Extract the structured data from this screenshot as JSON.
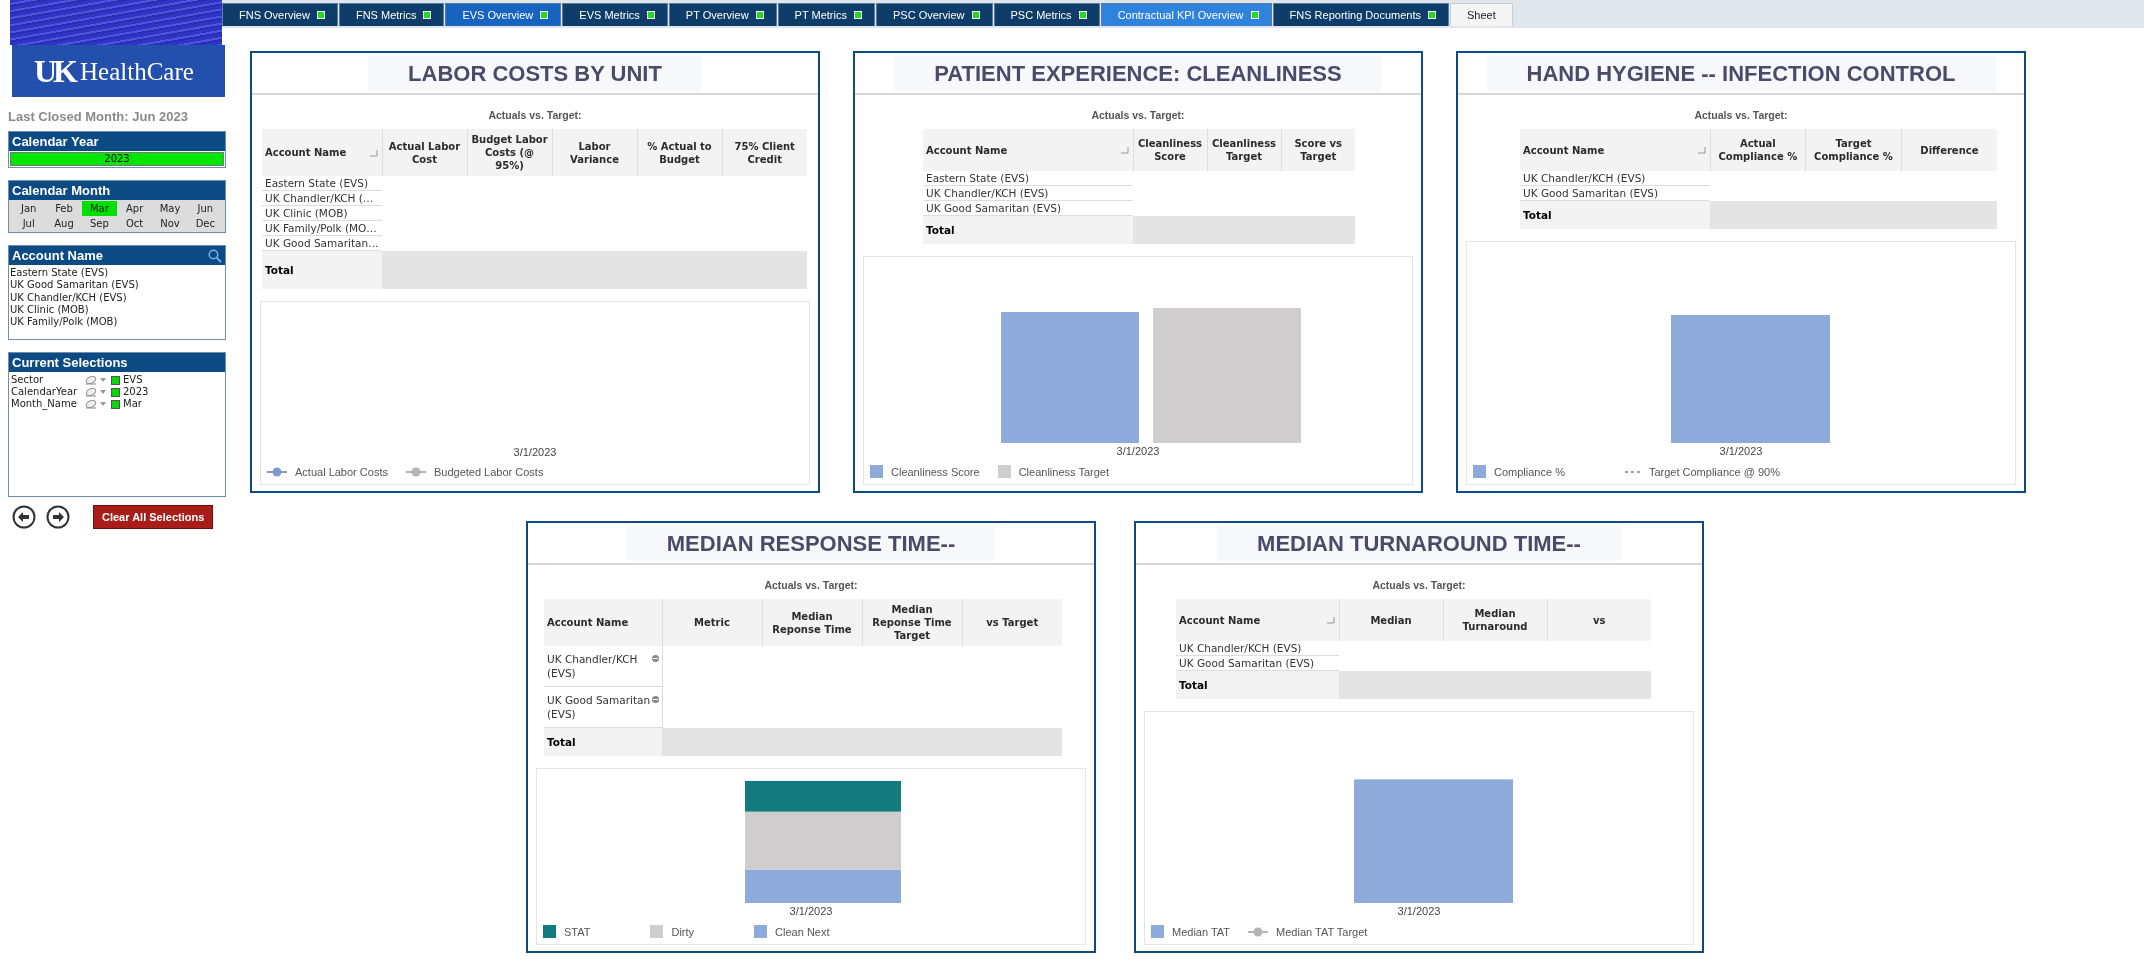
{
  "tabs": [
    {
      "label": "FNS Overview",
      "kind": "dashboard",
      "selected": false,
      "highlighted": false
    },
    {
      "label": "FNS Metrics",
      "kind": "dashboard",
      "selected": false,
      "highlighted": false
    },
    {
      "label": "EVS Overview",
      "kind": "dashboard",
      "selected": true,
      "highlighted": false
    },
    {
      "label": "EVS Metrics",
      "kind": "dashboard",
      "selected": false,
      "highlighted": false
    },
    {
      "label": "PT Overview",
      "kind": "dashboard",
      "selected": false,
      "highlighted": false
    },
    {
      "label": "PT Metrics",
      "kind": "dashboard",
      "selected": false,
      "highlighted": false
    },
    {
      "label": "PSC Overview",
      "kind": "dashboard",
      "selected": false,
      "highlighted": false
    },
    {
      "label": "PSC Metrics",
      "kind": "dashboard",
      "selected": false,
      "highlighted": false
    },
    {
      "label": "Contractual KPI Overview",
      "kind": "dashboard",
      "selected": false,
      "highlighted": true
    },
    {
      "label": "FNS Reporting Documents",
      "kind": "dashboard",
      "selected": false,
      "highlighted": false
    },
    {
      "label": "Sheet",
      "kind": "plain",
      "selected": false,
      "highlighted": false
    }
  ],
  "sidebar": {
    "logo": {
      "mark": "UK",
      "name": "HealthCare"
    },
    "last_closed": "Last Closed Month: Jun 2023",
    "calendar_year": {
      "title": "Calendar Year",
      "values": [
        {
          "label": "2023",
          "selected": true
        }
      ]
    },
    "calendar_month": {
      "title": "Calendar Month",
      "months": [
        {
          "label": "Jan",
          "selected": false
        },
        {
          "label": "Feb",
          "selected": false
        },
        {
          "label": "Mar",
          "selected": true
        },
        {
          "label": "Apr",
          "selected": false
        },
        {
          "label": "May",
          "selected": false
        },
        {
          "label": "Jun",
          "selected": false
        },
        {
          "label": "Jul",
          "selected": false
        },
        {
          "label": "Aug",
          "selected": false
        },
        {
          "label": "Sep",
          "selected": false
        },
        {
          "label": "Oct",
          "selected": false
        },
        {
          "label": "Nov",
          "selected": false
        },
        {
          "label": "Dec",
          "selected": false
        }
      ]
    },
    "account_name": {
      "title": "Account Name",
      "items": [
        "Eastern State (EVS)",
        "UK Good Samaritan (EVS)",
        "UK Chandler/KCH (EVS)",
        "UK Clinic (MOB)",
        "UK Family/Polk (MOB)"
      ]
    },
    "current_selections": {
      "title": "Current Selections",
      "rows": [
        {
          "field": "Sector",
          "value": "EVS"
        },
        {
          "field": "CalendarYear",
          "value": "2023"
        },
        {
          "field": "Month_Name",
          "value": "Mar"
        }
      ]
    },
    "clear_button": "Clear All Selections"
  },
  "panels": [
    {
      "title": "LABOR COSTS BY UNIT",
      "subtitle": "Actuals vs. Target:",
      "table": {
        "sort_indicator": true,
        "columns": [
          "Account Name",
          "Actual Labor Cost",
          "Budget Labor Costs (@ 95%)",
          "Labor Variance",
          "% Actual to Budget",
          "75% Client Credit"
        ],
        "rows": [
          {
            "name": "Eastern State (EVS)",
            "collapsible": false
          },
          {
            "name": "UK Chandler/KCH (…",
            "collapsible": false
          },
          {
            "name": "UK Clinic (MOB)",
            "collapsible": false
          },
          {
            "name": "UK Family/Polk (MO…",
            "collapsible": false
          },
          {
            "name": "UK Good Samaritan…",
            "collapsible": false
          }
        ],
        "total": "Total"
      },
      "chart": {
        "kind": "empty",
        "x_label": "3/1/2023",
        "legend": [
          {
            "label": "Actual Labor Costs",
            "kind": "line-marker",
            "color": "#7d9bd1"
          },
          {
            "label": "Budgeted Labor Costs",
            "kind": "line-marker",
            "color": "#b4b4b4"
          }
        ]
      }
    },
    {
      "title": "PATIENT EXPERIENCE: CLEANLINESS",
      "subtitle": "Actuals vs. Target:",
      "table": {
        "sort_indicator": true,
        "columns": [
          "Account Name",
          "Cleanliness Score",
          "Cleanliness Target",
          "Score vs Target"
        ],
        "rows": [
          {
            "name": "Eastern State (EVS)",
            "collapsible": false
          },
          {
            "name": "UK Chandler/KCH (EVS)",
            "collapsible": false
          },
          {
            "name": "UK Good Samaritan (EVS)",
            "collapsible": false
          }
        ],
        "total": "Total"
      },
      "chart": {
        "kind": "grouped",
        "x_label": "3/1/2023",
        "legend": [
          {
            "label": "Cleanliness Score",
            "kind": "swatch",
            "color": "#8eaadb"
          },
          {
            "label": "Cleanliness Target",
            "kind": "swatch",
            "color": "#d0cece"
          }
        ]
      }
    },
    {
      "title": "HAND HYGIENE -- INFECTION CONTROL",
      "subtitle": "Actuals vs. Target:",
      "table": {
        "sort_indicator": true,
        "columns": [
          "Account Name",
          "Actual Compliance %",
          "Target Compliance %",
          "Difference"
        ],
        "rows": [
          {
            "name": "UK Chandler/KCH (EVS)",
            "collapsible": false
          },
          {
            "name": "UK Good Samaritan (EVS)",
            "collapsible": false
          }
        ],
        "total": "Total"
      },
      "chart": {
        "kind": "single",
        "x_label": "3/1/2023",
        "legend": [
          {
            "label": "Compliance %",
            "kind": "swatch",
            "color": "#8eaadb"
          },
          {
            "label": "Target Compliance @ 90%",
            "kind": "dashed",
            "color": "#a0a0a0"
          }
        ]
      }
    },
    {
      "title": "MEDIAN RESPONSE TIME--",
      "subtitle": "Actuals vs. Target:",
      "table": {
        "sort_indicator": false,
        "columns": [
          "Account Name",
          "Metric",
          "Median Reponse Time",
          "Median Reponse Time Target",
          "vs Target"
        ],
        "rows": [
          {
            "name": "UK Chandler/KCH (EVS)",
            "collapsible": true
          },
          {
            "name": "UK Good Samaritan (EVS)",
            "collapsible": true
          }
        ],
        "total": "Total"
      },
      "chart": {
        "kind": "stacked",
        "x_label": "3/1/2023",
        "legend": [
          {
            "label": "STAT",
            "kind": "swatch",
            "color": "#137a80"
          },
          {
            "label": "Dirty",
            "kind": "swatch",
            "color": "#cfcdcd"
          },
          {
            "label": "Clean Next",
            "kind": "swatch",
            "color": "#8eaadb"
          }
        ]
      }
    },
    {
      "title": "MEDIAN TURNAROUND TIME--",
      "subtitle": "Actuals vs. Target:",
      "table": {
        "sort_indicator": true,
        "columns": [
          "Account Name",
          "Median",
          "Median Turnaround",
          "vs"
        ],
        "rows": [
          {
            "name": "UK Chandler/KCH (EVS)",
            "collapsible": false
          },
          {
            "name": "UK Good Samaritan (EVS)",
            "collapsible": false
          }
        ],
        "total": "Total"
      },
      "chart": {
        "kind": "single",
        "x_label": "3/1/2023",
        "legend": [
          {
            "label": "Median TAT",
            "kind": "swatch",
            "color": "#8eaadb"
          },
          {
            "label": "Median TAT Target",
            "kind": "line-marker",
            "color": "#b4b4b4"
          }
        ]
      }
    }
  ]
}
